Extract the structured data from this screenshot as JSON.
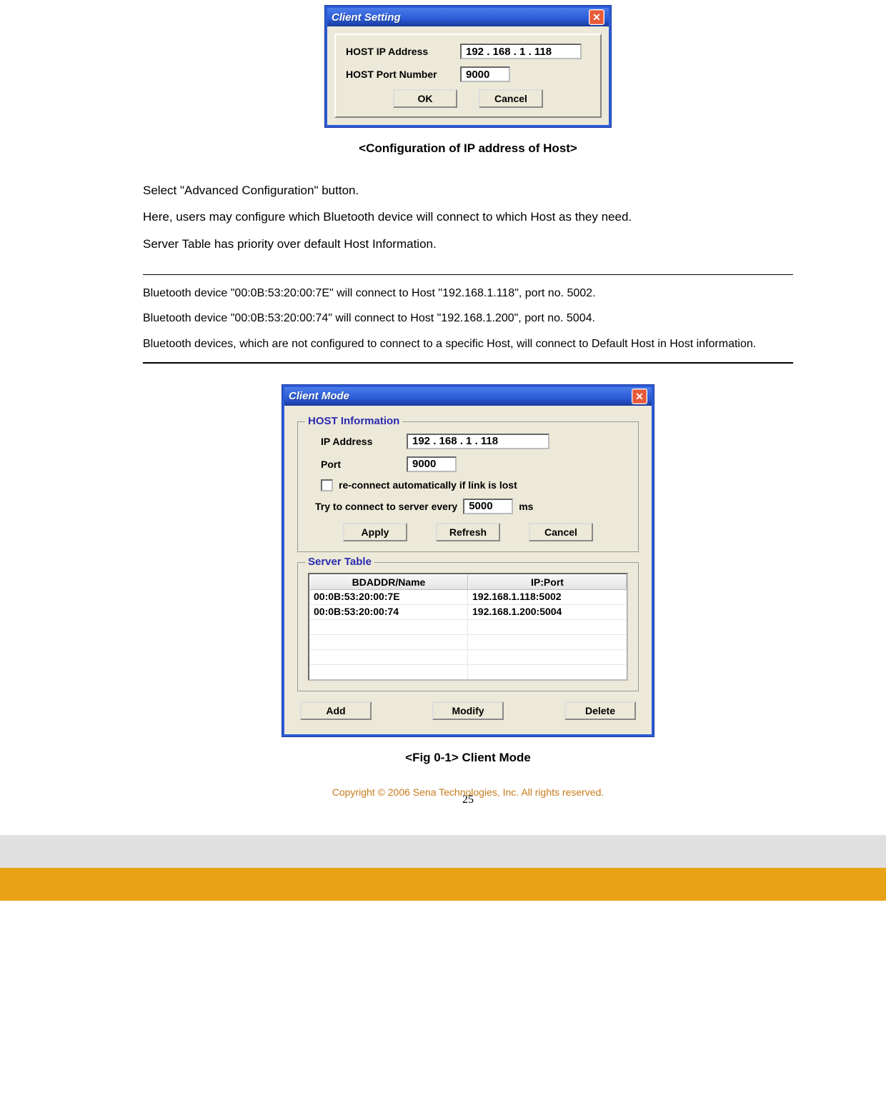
{
  "dialog1": {
    "title": "Client Setting",
    "close": "✕",
    "ip_label": "HOST IP Address",
    "ip_value": "192 . 168 .  1   . 118",
    "port_label": "HOST Port Number",
    "port_value": "9000",
    "ok": "OK",
    "cancel": "Cancel"
  },
  "caption1": "<Configuration of IP address of Host>",
  "para1": "Select \"Advanced Configuration\" button.",
  "para2": "Here, users may configure which Bluetooth device will connect to which Host as they need.",
  "para3": "Server Table has priority over default Host Information.",
  "example1": "Bluetooth device \"00:0B:53:20:00:7E\" will connect to Host \"192.168.1.118\", port no. 5002.",
  "example2": "Bluetooth device \"00:0B:53:20:00:74\" will connect to Host \"192.168.1.200\", port no. 5004.",
  "example3": "Bluetooth devices, which are not configured to connect to a specific Host, will connect to Default Host in Host information.",
  "dialog2": {
    "title": "Client Mode",
    "close": "✕",
    "hostinfo_legend": "HOST Information",
    "ip_label": "IP Address",
    "ip_value": "192 . 168 .  1   . 118",
    "port_label": "Port",
    "port_value": "9000",
    "reconnect_label": "re-connect automatically if link is lost",
    "try_label_pre": "Try to connect to server every",
    "try_value": "5000",
    "try_label_post": "ms",
    "apply": "Apply",
    "refresh": "Refresh",
    "cancel": "Cancel",
    "servertable_legend": "Server Table",
    "col_bdaddr": "BDADDR/Name",
    "col_ipport": "IP:Port",
    "rows": [
      {
        "bd": "00:0B:53:20:00:7E",
        "ip": "192.168.1.118:5002"
      },
      {
        "bd": "00:0B:53:20:00:74",
        "ip": "192.168.1.200:5004"
      }
    ],
    "add": "Add",
    "modify": "Modify",
    "delete": "Delete"
  },
  "caption2": "<Fig 0-1> Client Mode",
  "copyright": "Copyright © 2006 Sena Technologies, Inc. All rights reserved.",
  "page_number": "25"
}
